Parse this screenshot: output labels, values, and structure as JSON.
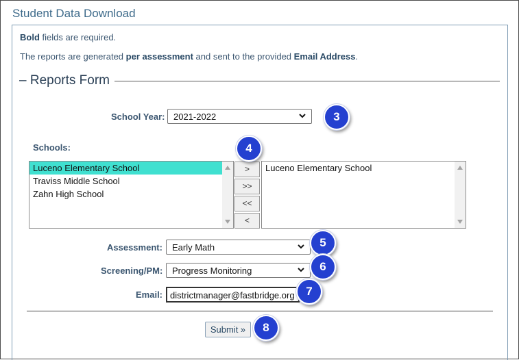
{
  "page": {
    "title": "Student Data Download"
  },
  "notes": {
    "bold_word": "Bold",
    "required_text": " fields are required.",
    "reports_prefix": "The reports are generated ",
    "reports_bold1": "per assessment",
    "reports_mid": " and sent to the provided ",
    "reports_bold2": "Email Address",
    "reports_end": "."
  },
  "form": {
    "legend": "Reports Form",
    "school_year": {
      "label": "School Year:",
      "value": "2021-2022"
    },
    "schools": {
      "label": "Schools:",
      "available": [
        "Luceno Elementary School",
        "Traviss Middle School",
        "Zahn High School"
      ],
      "selected_available": "Luceno Elementary School",
      "chosen": [
        "Luceno Elementary School"
      ]
    },
    "move_buttons": {
      "add": ">",
      "add_all": ">>",
      "remove_all": "<<",
      "remove": "<"
    },
    "assessment": {
      "label": "Assessment:",
      "value": "Early Math"
    },
    "screening": {
      "label": "Screening/PM:",
      "value": "Progress Monitoring"
    },
    "email": {
      "label": "Email:",
      "value": "districtmanager@fastbridge.org"
    },
    "submit_label": "Submit »"
  },
  "callouts": [
    "3",
    "4",
    "5",
    "6",
    "7",
    "8"
  ]
}
